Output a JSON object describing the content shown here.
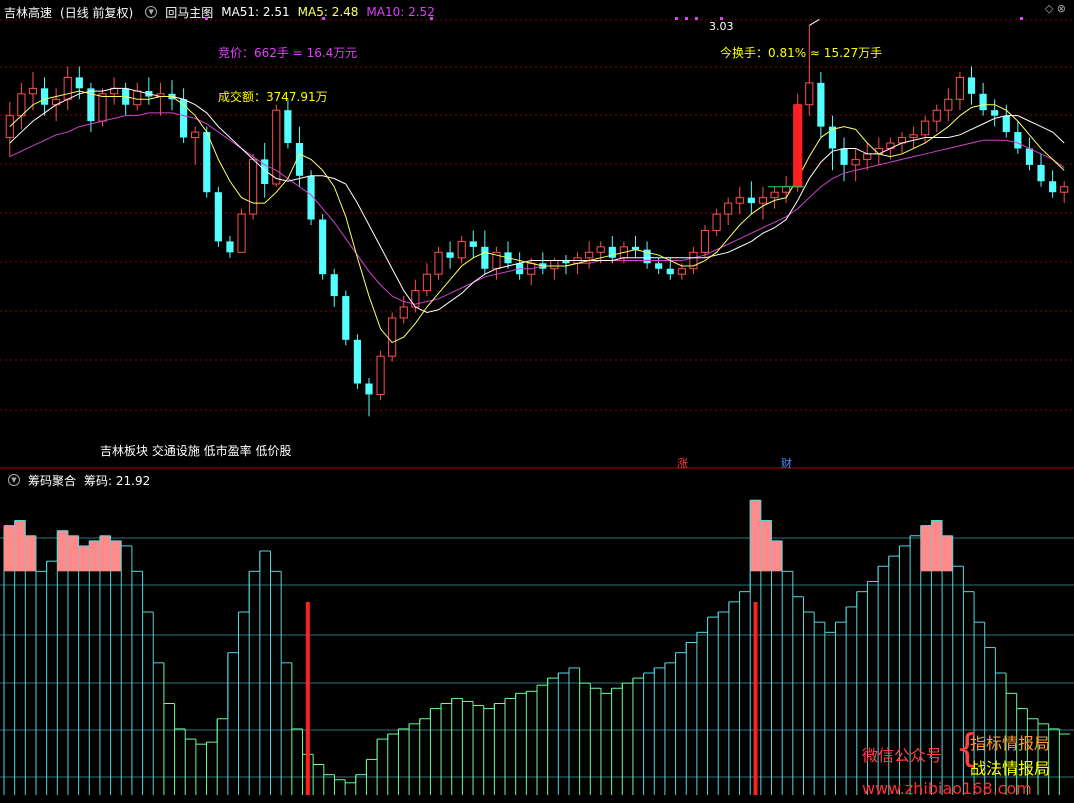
{
  "header": {
    "stock_name": "吉林高速",
    "period": "(日线 前复权)",
    "indicator_name": "回马主图",
    "ma51_label": "MA51: 2.51",
    "ma5_label": "MA5: 2.48",
    "ma10_label": "MA10: 2.52"
  },
  "annotations": {
    "bid": "竞价：662手 = 16.4万元",
    "volume": "成交额：3747.91万",
    "turnover": "今换手：0.81% ≈ 15.27万手",
    "high_price": "3.03",
    "tags": "吉林板块 交通设施 低市盈率 低价股",
    "flag_zhang": "涨",
    "flag_cai": "财"
  },
  "sub_header": {
    "indicator_name": "筹码聚合",
    "value_label": "筹码: 21.92"
  },
  "watermark": {
    "wechat": "微信公众号",
    "line1": "指标情报局",
    "line2": "战法情报局",
    "url": "www.zhibiao168.com"
  },
  "colors": {
    "up": "#ff5050",
    "down": "#54ffff",
    "ma5": "#ffff66",
    "ma10": "#ffffff",
    "ma51": "#cc44cc",
    "grid": "#8b0000",
    "label_pink": "#e040fb",
    "label_yellow": "#ffff00",
    "peak_pink": "#ff8a8a",
    "bar_cyan": "#4fd8e0",
    "bar_green": "#66ff99",
    "marker_red": "#ff2020"
  },
  "chart_data": [
    {
      "type": "candlestick",
      "title": "回马主图",
      "yrange_price": [
        1.55,
        3.05
      ],
      "candles": [
        [
          2.62,
          2.75,
          2.55,
          2.7
        ],
        [
          2.7,
          2.82,
          2.65,
          2.78
        ],
        [
          2.78,
          2.86,
          2.72,
          2.8
        ],
        [
          2.8,
          2.84,
          2.7,
          2.74
        ],
        [
          2.74,
          2.8,
          2.68,
          2.76
        ],
        [
          2.76,
          2.88,
          2.72,
          2.84
        ],
        [
          2.84,
          2.88,
          2.76,
          2.8
        ],
        [
          2.8,
          2.82,
          2.64,
          2.68
        ],
        [
          2.68,
          2.8,
          2.66,
          2.78
        ],
        [
          2.78,
          2.84,
          2.74,
          2.8
        ],
        [
          2.8,
          2.82,
          2.7,
          2.74
        ],
        [
          2.74,
          2.82,
          2.72,
          2.79
        ],
        [
          2.79,
          2.84,
          2.74,
          2.77
        ],
        [
          2.77,
          2.82,
          2.7,
          2.78
        ],
        [
          2.78,
          2.83,
          2.72,
          2.76
        ],
        [
          2.76,
          2.8,
          2.6,
          2.62
        ],
        [
          2.62,
          2.66,
          2.52,
          2.64
        ],
        [
          2.64,
          2.66,
          2.4,
          2.42
        ],
        [
          2.42,
          2.44,
          2.22,
          2.24
        ],
        [
          2.24,
          2.26,
          2.18,
          2.2
        ],
        [
          2.2,
          2.36,
          2.2,
          2.34
        ],
        [
          2.34,
          2.56,
          2.32,
          2.54
        ],
        [
          2.54,
          2.6,
          2.4,
          2.45
        ],
        [
          2.45,
          2.74,
          2.44,
          2.72
        ],
        [
          2.72,
          2.76,
          2.58,
          2.6
        ],
        [
          2.6,
          2.66,
          2.44,
          2.48
        ],
        [
          2.48,
          2.5,
          2.3,
          2.32
        ],
        [
          2.32,
          2.34,
          2.1,
          2.12
        ],
        [
          2.12,
          2.14,
          2.0,
          2.04
        ],
        [
          2.04,
          2.06,
          1.86,
          1.88
        ],
        [
          1.88,
          1.9,
          1.7,
          1.72
        ],
        [
          1.72,
          1.74,
          1.6,
          1.68
        ],
        [
          1.68,
          1.84,
          1.66,
          1.82
        ],
        [
          1.82,
          1.98,
          1.8,
          1.96
        ],
        [
          1.96,
          2.04,
          1.94,
          2.0
        ],
        [
          2.0,
          2.1,
          1.98,
          2.06
        ],
        [
          2.06,
          2.16,
          2.04,
          2.12
        ],
        [
          2.12,
          2.22,
          2.1,
          2.2
        ],
        [
          2.2,
          2.24,
          2.14,
          2.18
        ],
        [
          2.18,
          2.26,
          2.16,
          2.24
        ],
        [
          2.24,
          2.28,
          2.18,
          2.22
        ],
        [
          2.22,
          2.28,
          2.12,
          2.14
        ],
        [
          2.14,
          2.22,
          2.1,
          2.2
        ],
        [
          2.2,
          2.24,
          2.14,
          2.16
        ],
        [
          2.16,
          2.2,
          2.1,
          2.12
        ],
        [
          2.12,
          2.18,
          2.08,
          2.16
        ],
        [
          2.16,
          2.2,
          2.12,
          2.14
        ],
        [
          2.14,
          2.18,
          2.1,
          2.17
        ],
        [
          2.17,
          2.19,
          2.12,
          2.16
        ],
        [
          2.16,
          2.2,
          2.12,
          2.18
        ],
        [
          2.18,
          2.24,
          2.14,
          2.2
        ],
        [
          2.2,
          2.24,
          2.16,
          2.22
        ],
        [
          2.22,
          2.26,
          2.16,
          2.18
        ],
        [
          2.18,
          2.24,
          2.16,
          2.22
        ],
        [
          2.22,
          2.26,
          2.18,
          2.21
        ],
        [
          2.21,
          2.24,
          2.14,
          2.16
        ],
        [
          2.16,
          2.18,
          2.12,
          2.14
        ],
        [
          2.14,
          2.18,
          2.1,
          2.12
        ],
        [
          2.12,
          2.16,
          2.1,
          2.14
        ],
        [
          2.14,
          2.22,
          2.12,
          2.2
        ],
        [
          2.2,
          2.3,
          2.18,
          2.28
        ],
        [
          2.28,
          2.36,
          2.26,
          2.34
        ],
        [
          2.34,
          2.4,
          2.3,
          2.38
        ],
        [
          2.38,
          2.44,
          2.34,
          2.4
        ],
        [
          2.4,
          2.46,
          2.34,
          2.38
        ],
        [
          2.38,
          2.44,
          2.32,
          2.4
        ],
        [
          2.4,
          2.44,
          2.36,
          2.42
        ],
        [
          2.42,
          2.48,
          2.38,
          2.44
        ],
        [
          2.44,
          2.78,
          2.42,
          2.74
        ],
        [
          2.74,
          3.03,
          2.7,
          2.82
        ],
        [
          2.82,
          2.86,
          2.62,
          2.66
        ],
        [
          2.66,
          2.7,
          2.5,
          2.58
        ],
        [
          2.58,
          2.62,
          2.46,
          2.52
        ],
        [
          2.52,
          2.58,
          2.46,
          2.54
        ],
        [
          2.54,
          2.6,
          2.5,
          2.56
        ],
        [
          2.56,
          2.62,
          2.52,
          2.58
        ],
        [
          2.58,
          2.62,
          2.54,
          2.6
        ],
        [
          2.6,
          2.64,
          2.56,
          2.62
        ],
        [
          2.62,
          2.66,
          2.58,
          2.63
        ],
        [
          2.63,
          2.7,
          2.6,
          2.68
        ],
        [
          2.68,
          2.74,
          2.64,
          2.72
        ],
        [
          2.72,
          2.8,
          2.68,
          2.76
        ],
        [
          2.76,
          2.86,
          2.72,
          2.84
        ],
        [
          2.84,
          2.88,
          2.74,
          2.78
        ],
        [
          2.78,
          2.82,
          2.7,
          2.72
        ],
        [
          2.72,
          2.76,
          2.66,
          2.7
        ],
        [
          2.7,
          2.74,
          2.62,
          2.64
        ],
        [
          2.64,
          2.68,
          2.56,
          2.58
        ],
        [
          2.58,
          2.62,
          2.5,
          2.52
        ],
        [
          2.52,
          2.56,
          2.44,
          2.46
        ],
        [
          2.46,
          2.5,
          2.4,
          2.42
        ],
        [
          2.42,
          2.46,
          2.38,
          2.44
        ]
      ],
      "ma5": [
        2.66,
        2.7,
        2.74,
        2.76,
        2.77,
        2.78,
        2.79,
        2.78,
        2.77,
        2.77,
        2.77,
        2.76,
        2.76,
        2.77,
        2.77,
        2.74,
        2.7,
        2.64,
        2.54,
        2.46,
        2.4,
        2.38,
        2.38,
        2.42,
        2.47,
        2.56,
        2.54,
        2.5,
        2.44,
        2.33,
        2.18,
        2.04,
        1.92,
        1.87,
        1.89,
        1.94,
        2.0,
        2.05,
        2.1,
        2.15,
        2.18,
        2.2,
        2.19,
        2.18,
        2.17,
        2.16,
        2.15,
        2.15,
        2.15,
        2.16,
        2.17,
        2.18,
        2.19,
        2.2,
        2.21,
        2.2,
        2.19,
        2.17,
        2.15,
        2.15,
        2.17,
        2.2,
        2.25,
        2.3,
        2.34,
        2.37,
        2.39,
        2.4,
        2.47,
        2.55,
        2.62,
        2.65,
        2.66,
        2.65,
        2.6,
        2.56,
        2.55,
        2.56,
        2.58,
        2.6,
        2.63,
        2.66,
        2.7,
        2.73,
        2.74,
        2.74,
        2.72,
        2.68,
        2.63,
        2.58,
        2.54,
        2.5
      ],
      "ma10": [
        2.6,
        2.64,
        2.68,
        2.71,
        2.74,
        2.76,
        2.78,
        2.79,
        2.79,
        2.8,
        2.8,
        2.79,
        2.78,
        2.77,
        2.77,
        2.76,
        2.74,
        2.71,
        2.66,
        2.62,
        2.58,
        2.54,
        2.5,
        2.47,
        2.46,
        2.47,
        2.48,
        2.48,
        2.47,
        2.45,
        2.38,
        2.3,
        2.22,
        2.14,
        2.06,
        2.0,
        1.98,
        1.99,
        2.02,
        2.05,
        2.09,
        2.12,
        2.14,
        2.15,
        2.16,
        2.17,
        2.17,
        2.17,
        2.17,
        2.17,
        2.17,
        2.17,
        2.17,
        2.18,
        2.18,
        2.18,
        2.18,
        2.18,
        2.18,
        2.18,
        2.18,
        2.19,
        2.2,
        2.22,
        2.24,
        2.27,
        2.29,
        2.32,
        2.39,
        2.47,
        2.53,
        2.57,
        2.58,
        2.58,
        2.56,
        2.56,
        2.58,
        2.6,
        2.61,
        2.62,
        2.62,
        2.62,
        2.63,
        2.65,
        2.67,
        2.69,
        2.7,
        2.7,
        2.68,
        2.66,
        2.64,
        2.6
      ],
      "ma51": [
        2.55,
        2.57,
        2.59,
        2.61,
        2.63,
        2.64,
        2.66,
        2.67,
        2.68,
        2.69,
        2.7,
        2.7,
        2.71,
        2.71,
        2.71,
        2.7,
        2.69,
        2.67,
        2.64,
        2.61,
        2.58,
        2.55,
        2.52,
        2.5,
        2.47,
        2.44,
        2.41,
        2.36,
        2.31,
        2.25,
        2.19,
        2.13,
        2.08,
        2.04,
        2.02,
        2.01,
        2.02,
        2.03,
        2.05,
        2.07,
        2.09,
        2.11,
        2.12,
        2.13,
        2.14,
        2.14,
        2.15,
        2.15,
        2.15,
        2.16,
        2.16,
        2.17,
        2.17,
        2.17,
        2.17,
        2.17,
        2.17,
        2.17,
        2.17,
        2.18,
        2.19,
        2.21,
        2.23,
        2.25,
        2.27,
        2.29,
        2.31,
        2.33,
        2.36,
        2.4,
        2.44,
        2.47,
        2.49,
        2.5,
        2.51,
        2.52,
        2.53,
        2.54,
        2.55,
        2.56,
        2.57,
        2.58,
        2.59,
        2.6,
        2.61,
        2.61,
        2.61,
        2.6,
        2.58,
        2.56,
        2.54,
        2.51
      ]
    },
    {
      "type": "bar",
      "title": "筹码聚合",
      "ylim": [
        0,
        30
      ],
      "values": [
        26.5,
        27.0,
        25.5,
        22.0,
        23.0,
        26.0,
        25.5,
        24.5,
        25.0,
        25.5,
        25.0,
        24.5,
        22.0,
        18.0,
        13.0,
        9.0,
        6.5,
        5.5,
        5.0,
        5.2,
        7.5,
        14.0,
        18.0,
        22.0,
        24.0,
        22.0,
        13.0,
        6.5,
        4.0,
        3.0,
        2.0,
        1.5,
        1.2,
        2.0,
        3.5,
        5.5,
        6.0,
        6.5,
        7.0,
        7.5,
        8.5,
        9.0,
        9.5,
        9.2,
        8.8,
        8.5,
        9.0,
        9.5,
        10.0,
        10.2,
        10.8,
        11.5,
        12.0,
        12.5,
        11.0,
        10.5,
        10.0,
        10.5,
        11.0,
        11.5,
        12.0,
        12.5,
        13.0,
        14.0,
        15.0,
        16.0,
        17.5,
        18.0,
        19.0,
        20.0,
        29.0,
        27.0,
        25.0,
        22.0,
        19.5,
        18.0,
        17.0,
        16.0,
        17.0,
        18.5,
        20.0,
        21.0,
        22.5,
        23.5,
        24.5,
        25.5,
        26.5,
        27.0,
        25.5,
        22.5,
        20.0,
        17.0,
        14.5,
        12.0,
        10.0,
        8.5,
        7.5,
        7.0,
        6.5,
        6.0
      ],
      "peaks": [
        [
          0,
          22.0
        ],
        [
          1,
          22.0
        ],
        [
          2,
          22.0
        ],
        [
          5,
          22.0
        ],
        [
          6,
          22.0
        ],
        [
          7,
          22.0
        ],
        [
          8,
          22.0
        ],
        [
          9,
          22.0
        ],
        [
          10,
          22.0
        ],
        [
          23,
          22.0
        ],
        [
          70,
          22.0
        ],
        [
          71,
          22.0
        ],
        [
          72,
          22.0
        ],
        [
          86,
          22.0
        ],
        [
          87,
          22.0
        ],
        [
          88,
          22.0
        ]
      ],
      "markers": [
        28,
        70
      ]
    }
  ]
}
